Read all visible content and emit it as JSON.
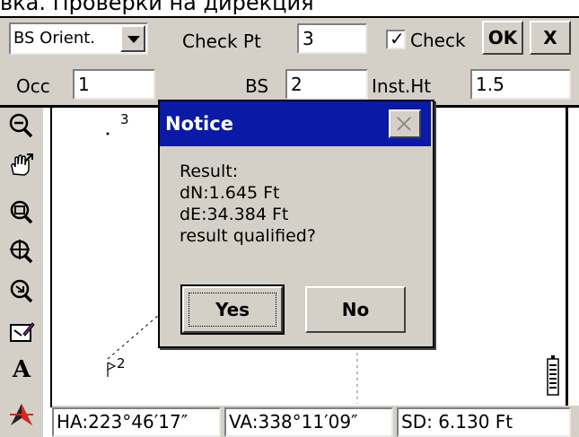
{
  "caption": "вка. Проверки на дирекция",
  "form": {
    "orient_select": "BS Orient.",
    "check_pt_label": "Check Pt",
    "check_pt_value": "3",
    "check_label": "Check",
    "check_checked": true,
    "ok_label": "OK",
    "x_label": "X",
    "occ_label": "Occ",
    "occ_value": "1",
    "bs_label": "BS",
    "bs_value": "2",
    "inst_ht_label": "Inst.Ht",
    "inst_ht_value": "1.5"
  },
  "toolbar": {
    "tools": [
      "zoom-out-icon",
      "pan-hand-icon",
      "zoom-window-icon",
      "zoom-extents-icon",
      "zoom-previous-icon",
      "edit-layer-icon",
      "text-icon",
      "compass-icon"
    ],
    "text_glyph": "A"
  },
  "map": {
    "point_3_label": "3",
    "point_2_label": "2"
  },
  "status": {
    "ha": "HA:223°46′17″",
    "va": "VA:338°11′09″",
    "sd": "SD:   6.130 Ft"
  },
  "dialog": {
    "title": "Notice",
    "lines": [
      "Result:",
      "dN:1.645 Ft",
      "dE:34.384 Ft",
      "result qualified?"
    ],
    "yes_label": "Yes",
    "no_label": "No"
  }
}
